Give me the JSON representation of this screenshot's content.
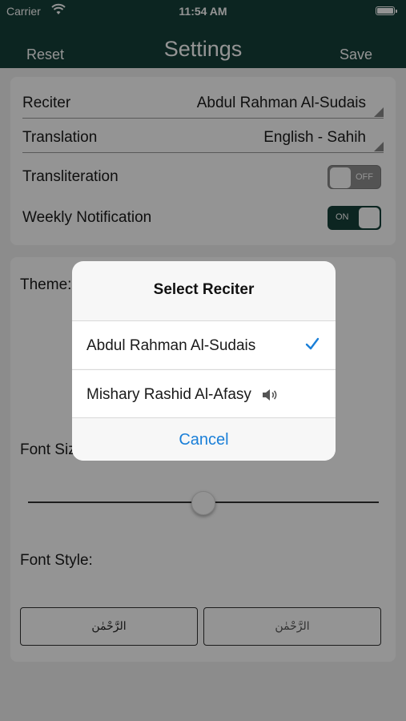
{
  "status_bar": {
    "carrier": "Carrier",
    "time": "11:54 AM"
  },
  "nav": {
    "reset": "Reset",
    "title": "Settings",
    "save": "Save",
    "color": "#16403a"
  },
  "settings": {
    "reciter_label": "Reciter",
    "reciter_value": "Abdul Rahman Al-Sudais",
    "translation_label": "Translation",
    "translation_value": "English - Sahih",
    "transliteration_label": "Transliteration",
    "transliteration_state": "OFF",
    "weekly_label": "Weekly Notification",
    "weekly_state": "ON"
  },
  "appearance": {
    "theme_label": "Theme:",
    "font_size_label": "Font Size:",
    "font_size_level": 0.5,
    "font_style_label": "Font Style:",
    "font_style_options": [
      "الرَّحْمٰن",
      "الرَّحْمٰن"
    ]
  },
  "dialog": {
    "title": "Select Reciter",
    "options": [
      {
        "label": "Abdul Rahman Al-Sudais",
        "selected": true
      },
      {
        "label": "Mishary Rashid Al-Afasy",
        "icon": "speaker-icon"
      }
    ],
    "cancel": "Cancel",
    "accent": "#1a7fd8"
  }
}
